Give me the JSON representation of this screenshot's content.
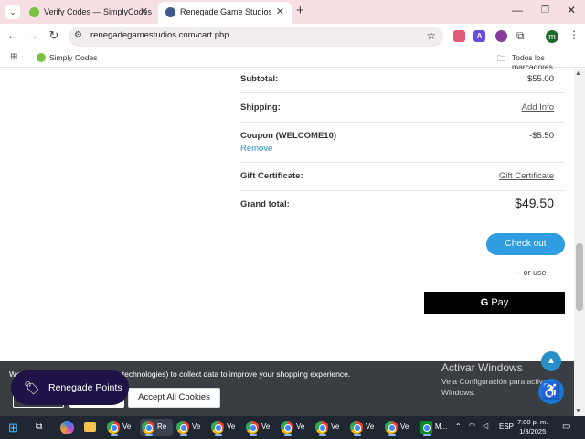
{
  "browser": {
    "tabs": [
      {
        "title": "Verify Codes — SimplyCodes",
        "active": false
      },
      {
        "title": "Renegade Game Studios - Shop",
        "active": true
      }
    ],
    "url": "renegadegamestudios.com/cart.php",
    "bookmarks": [
      {
        "label": "Simply Codes"
      },
      {
        "label": "Todos los marcadores"
      }
    ],
    "profile_initial": "m"
  },
  "cart": {
    "subtotal_label": "Subtotal:",
    "subtotal_value": "$55.00",
    "shipping_label": "Shipping:",
    "shipping_link": "Add Info",
    "coupon_label": "Coupon (WELCOME10)",
    "coupon_value": "-$5.50",
    "remove_label": "Remove",
    "gift_label": "Gift Certificate:",
    "gift_link": "Gift Certificate",
    "total_label": "Grand total:",
    "total_value": "$49.50",
    "checkout_label": "Check out",
    "or_use": "-- or use --",
    "gpay_g": "G",
    "gpay_label": "Pay"
  },
  "cookie": {
    "text": "We (and selected third-party technologies) to collect data to improve your shopping experience.",
    "text_prefix": "We",
    "text_suffix": "(or technologies) to collect data to improve your shopping experience.",
    "accept_label": "Accept All Cookies"
  },
  "widgets": {
    "points_label": "Renegade Points"
  },
  "windows_activation": {
    "title": "Activar Windows",
    "subtitle": "Ve a Configuración para activar Windows."
  },
  "taskbar": {
    "items": [
      {
        "label": "Ve"
      },
      {
        "label": "Re"
      },
      {
        "label": "Ve"
      },
      {
        "label": "Ve"
      },
      {
        "label": "Ve"
      },
      {
        "label": "Ve"
      },
      {
        "label": "Ve"
      },
      {
        "label": "Ve"
      },
      {
        "label": "Ve"
      },
      {
        "label": "M..."
      }
    ],
    "language": "ESP",
    "time": "7:00 p. m.",
    "date": "1/3/2025"
  }
}
